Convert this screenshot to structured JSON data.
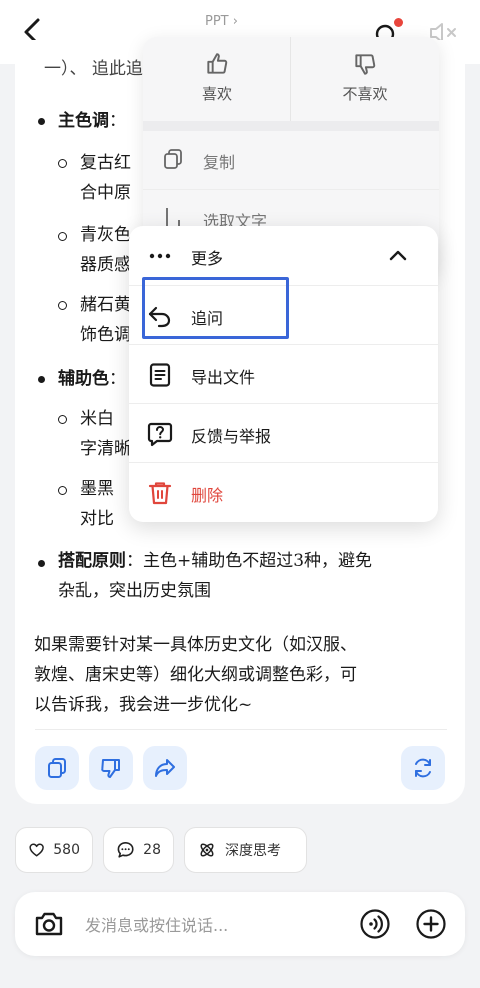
{
  "topbar": {
    "title": "PPT ›"
  },
  "content": {
    "line_cut": "一）、 追此追",
    "main_color_label": "主色调",
    "main_color_colon": "：",
    "sub1_line1": "复古红",
    "sub1_line2": "合中原",
    "sub2_line1": "青灰色",
    "sub2_line2": "器质感",
    "sub3_line1": "赭石黄",
    "sub3_line2": "饰色调",
    "aux_color_label": "辅助色",
    "aux_color_colon": "：",
    "sub4_line1": "米白",
    "sub4_line2": "字清晰",
    "sub5_line1": "墨黑",
    "sub5_line2": "对比",
    "rule_label": "搭配原则",
    "rule_text": "：主色+辅助色不超过3种，避免",
    "rule_text2": "杂乱，突出历史氛围",
    "para_line1": "如果需要针对某一具体历史文化（如汉服、",
    "para_line2": "敦煌、唐宋史等）细化大纲或调整色彩，可",
    "para_line3": "以告诉我，我会进一步优化~"
  },
  "chips": {
    "likes_count": "580",
    "comments_count": "28",
    "deep_think_label": "深度思考"
  },
  "input": {
    "placeholder": "发消息或按住说话..."
  },
  "menu_top": {
    "like_label": "喜欢",
    "dislike_label": "不喜欢",
    "copy_label": "复制",
    "select_text_label": "选取文字"
  },
  "menu_more": {
    "more_label": "更多",
    "follow_up_label": "追问",
    "export_label": "导出文件",
    "feedback_label": "反馈与举报",
    "delete_label": "删除"
  },
  "colors": {
    "accent": "#3a66d8",
    "danger": "#e0463c",
    "chip_bg": "#e7f0fd",
    "icon_blue": "#2f6fe0"
  }
}
